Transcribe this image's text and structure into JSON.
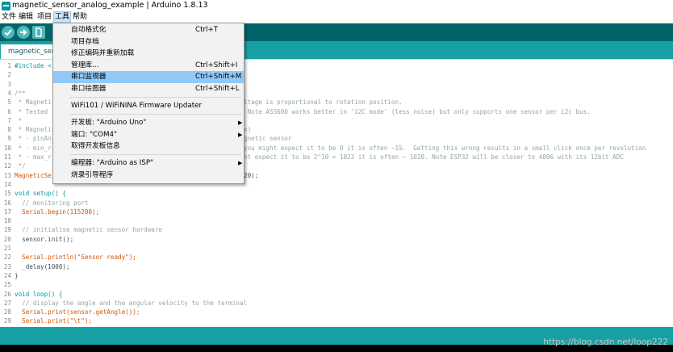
{
  "window": {
    "title": "magnetic_sensor_analog_example | Arduino 1.8.13"
  },
  "menubar": {
    "items": [
      "文件",
      "编辑",
      "项目",
      "工具",
      "帮助"
    ],
    "active": "工具"
  },
  "toolbar": {
    "verify_icon": "check-icon",
    "upload_icon": "arrow-right-icon",
    "new_icon": "new-file-icon"
  },
  "tab": {
    "label": "magnetic_sensor_analog_example"
  },
  "tools_menu": {
    "items": [
      {
        "label": "自动格式化",
        "shortcut": "Ctrl+T"
      },
      {
        "label": "项目存档",
        "shortcut": ""
      },
      {
        "label": "修正编码并重新加载",
        "shortcut": ""
      },
      {
        "label": "管理库...",
        "shortcut": "Ctrl+Shift+I"
      },
      {
        "label": "串口监视器",
        "shortcut": "Ctrl+Shift+M"
      },
      {
        "label": "串口绘图器",
        "shortcut": "Ctrl+Shift+L"
      },
      {
        "label": "WiFi101 / WiFiNINA Firmware Updater",
        "shortcut": ""
      },
      {
        "label": "开发板: \"Arduino Uno\"",
        "shortcut": ""
      },
      {
        "label": "端口: \"COM4\"",
        "shortcut": ""
      },
      {
        "label": "取得开发板信息",
        "shortcut": ""
      },
      {
        "label": "编程器: \"Arduino as ISP\"",
        "shortcut": ""
      },
      {
        "label": "烧录引导程序",
        "shortcut": ""
      }
    ],
    "highlighted": "串口监视器"
  },
  "code": {
    "lines": [
      {
        "n": "1",
        "text": "#include <"
      },
      {
        "n": "2",
        "text": ""
      },
      {
        "n": "3",
        "text": ""
      },
      {
        "n": "4",
        "text": "/**"
      },
      {
        "n": "5",
        "text": " * Magneti",
        "tail": "ltage is proportional to rotation position."
      },
      {
        "n": "6",
        "text": " * Tested",
        "tail": " Note AS5600 works better in 'i2C mode' (less noise) but only supports one sensor per i2c bus."
      },
      {
        "n": "7",
        "text": " *"
      },
      {
        "n": "8",
        "text": " * Magneti",
        "tail": "x)"
      },
      {
        "n": "9",
        "text": " * - pinAn",
        "tail": "gnetic sensor"
      },
      {
        "n": "10",
        "text": " * - min_r",
        "tail": "you might expect it to be 0 it is often ~15.  Getting this wrong results in a small click once per revolution"
      },
      {
        "n": "11",
        "text": " * - max_r",
        "tail": "ht expect it to be 2^10 = 1023 it is often ~ 1020. Note ESP32 will be closer to 4096 with its 12bit ADC"
      },
      {
        "n": "12",
        "text": " */"
      },
      {
        "n": "13",
        "text": "MagneticSe",
        "tail": "20);"
      },
      {
        "n": "14",
        "text": ""
      },
      {
        "n": "15",
        "text": "void setup() {"
      },
      {
        "n": "16",
        "text": "  // monitoring port"
      },
      {
        "n": "17",
        "text": "  Serial.begin(115200);"
      },
      {
        "n": "18",
        "text": ""
      },
      {
        "n": "19",
        "text": "  // initialise magnetic sensor hardware"
      },
      {
        "n": "20",
        "text": "  sensor.init();"
      },
      {
        "n": "21",
        "text": ""
      },
      {
        "n": "22",
        "text": "  Serial.println(\"Sensor ready\");"
      },
      {
        "n": "23",
        "text": "  _delay(1000);"
      },
      {
        "n": "24",
        "text": "}"
      },
      {
        "n": "25",
        "text": ""
      },
      {
        "n": "26",
        "text": "void loop() {"
      },
      {
        "n": "27",
        "text": "  // display the angle and the angular velocity to the terminal"
      },
      {
        "n": "28",
        "text": "  Serial.print(sensor.getAngle());"
      },
      {
        "n": "29",
        "text": "  Serial.print(\"\\t\");"
      }
    ]
  },
  "watermark": "https://blog.csdn.net/loop222",
  "colors": {
    "toolbar": "#006468",
    "tabstrip": "#17a1a5",
    "highlight": "#91c9f7"
  }
}
